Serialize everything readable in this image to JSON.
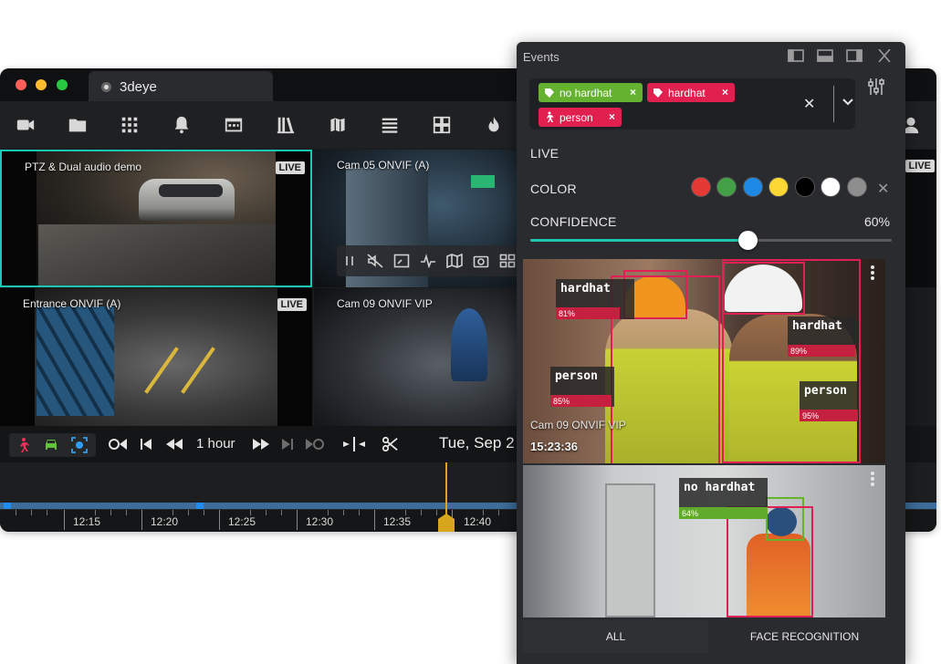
{
  "app": {
    "title": "3deye"
  },
  "toolbar": {
    "icons": [
      "video-camera-icon",
      "folder-icon",
      "grid-dots-icon",
      "bell-icon",
      "calendar-card-icon",
      "library-icon",
      "map-icon",
      "list-icon",
      "layout-grid-icon",
      "fire-icon"
    ]
  },
  "cameras": [
    {
      "name": "PTZ & Dual audio demo",
      "badge": "LIVE"
    },
    {
      "name": "Cam 05 ONVIF (A)",
      "badge": ""
    },
    {
      "name": "Entrance ONVIF (A)",
      "badge": "LIVE"
    },
    {
      "name": "Cam 09 ONVIF VIP",
      "badge": ""
    },
    {
      "name": "",
      "badge": "LIVE"
    }
  ],
  "camera_overlay": {
    "icons": [
      "pause-icon",
      "mute-icon",
      "fullscreen-icon",
      "activity-icon",
      "map-icon",
      "snapshot-icon",
      "grid-icon"
    ]
  },
  "timeline": {
    "range": "1 hour",
    "date": "Tue, Sep 2",
    "ticks": [
      "12:15",
      "12:20",
      "12:25",
      "12:30",
      "12:35",
      "12:40"
    ]
  },
  "events_panel": {
    "title": "Events",
    "filters": [
      {
        "label": "no hardhat",
        "color": "#65b230"
      },
      {
        "label": "hardhat",
        "color": "#e1204f"
      },
      {
        "label": "person",
        "color": "#e1204f"
      }
    ],
    "live_label": "LIVE",
    "color_label": "COLOR",
    "colors": [
      "#e53935",
      "#43a047",
      "#1e88e5",
      "#fdd835",
      "#000000",
      "#ffffff",
      "#8e8e8e"
    ],
    "confidence_label": "CONFIDENCE",
    "confidence_value": "60%",
    "confidence_fraction": 0.6,
    "cards": [
      {
        "camera": "Cam 09 ONVIF VIP",
        "time": "15:23:36",
        "detections": [
          {
            "label": "hardhat",
            "score": "81%"
          },
          {
            "label": "hardhat",
            "score": "89%"
          },
          {
            "label": "person",
            "score": "85%"
          },
          {
            "label": "person",
            "score": "95%"
          }
        ]
      },
      {
        "detections": [
          {
            "label": "no hardhat",
            "score": "64%"
          }
        ]
      }
    ],
    "tabs": {
      "all": "ALL",
      "face": "FACE RECOGNITION"
    },
    "accent": "#1fc4ac"
  }
}
